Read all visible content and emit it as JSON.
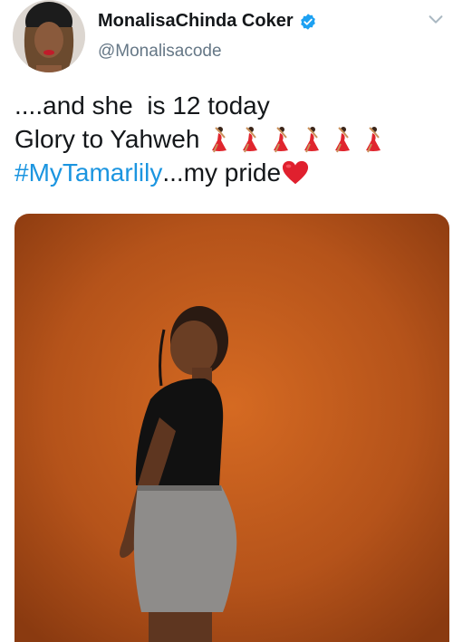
{
  "user": {
    "display_name": "MonalisaChinda Coker",
    "handle": "@Monalisacode"
  },
  "icons": {
    "avatar": "avatar-photo",
    "verified": "verified-badge-icon",
    "more": "chevron-down-icon",
    "dancer": "woman-dancing-emoji",
    "heart": "red-heart-emoji"
  },
  "colors": {
    "link": "#1b95e0",
    "verified": "#1da1f2",
    "photo_background": "#c35a17"
  },
  "tweet": {
    "line1": "....and she  is 12 today",
    "line2": "Glory to Yahweh",
    "hashtag": "#MyTamarlily",
    "line3_suffix": "...my pride"
  }
}
